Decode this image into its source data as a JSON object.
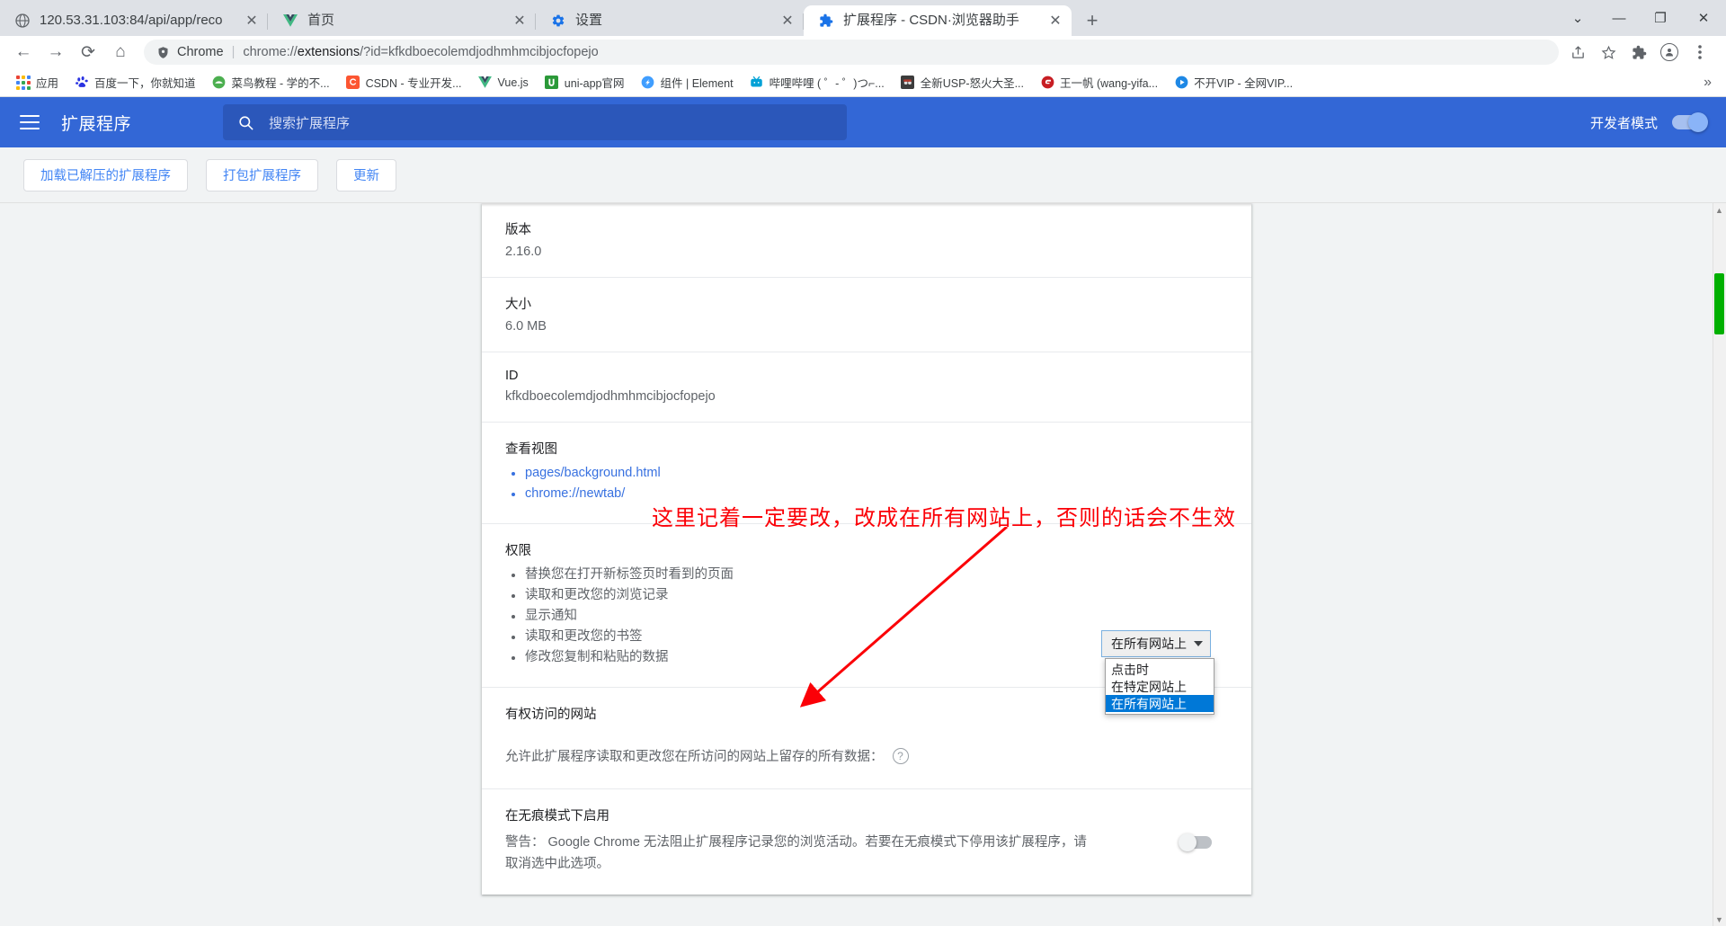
{
  "window": {
    "controls": {
      "minimize": "—",
      "maximize": "❐",
      "close": "✕",
      "list_tabs": "⌄"
    }
  },
  "tabs": [
    {
      "title": "120.53.31.103:84/api/app/reco",
      "favicon": "globe-icon",
      "active": false,
      "close": "✕"
    },
    {
      "title": "首页",
      "favicon": "vue-icon",
      "active": false,
      "close": "✕"
    },
    {
      "title": "设置",
      "favicon": "settings-gear-icon",
      "active": false,
      "close": "✕"
    },
    {
      "title": "扩展程序 - CSDN·浏览器助手",
      "favicon": "puzzle-icon",
      "active": true,
      "close": "✕"
    }
  ],
  "newtab_label": "+",
  "omnibox": {
    "back": "←",
    "forward": "→",
    "reload": "⟳",
    "home": "⌂",
    "chrome_label": "Chrome",
    "separator": "|",
    "url_prefix": "chrome://",
    "url_bold": "extensions",
    "url_suffix": "/?id=kfkdboecolemdjodhmhmcibjocfopejo",
    "full_url": "chrome://extensions/?id=kfkdboecolemdjodhmhmcibjocfopejo",
    "share_icon": "share-icon",
    "bookmark_icon": "star-icon",
    "extensions_icon": "puzzle-icon",
    "profile_icon": "profile-avatar-icon",
    "menu_icon": "more-vertical-icon"
  },
  "bookmarks": {
    "items": [
      {
        "label": "应用",
        "icon": "apps-grid-icon"
      },
      {
        "label": "百度一下，你就知道",
        "icon": "baidu-icon"
      },
      {
        "label": "菜鸟教程 - 学的不...",
        "icon": "runoob-icon"
      },
      {
        "label": "CSDN - 专业开发...",
        "icon": "csdn-icon"
      },
      {
        "label": "Vue.js",
        "icon": "vue-icon"
      },
      {
        "label": "uni-app官网",
        "icon": "uniapp-icon"
      },
      {
        "label": "组件 | Element",
        "icon": "element-icon"
      },
      {
        "label": "哔哩哔哩 ( ゜- ゜)つ⌐...",
        "icon": "bilibili-icon"
      },
      {
        "label": "全新USP-怒火大圣...",
        "icon": "usp-icon"
      },
      {
        "label": "王一帆 (wang-yifa...",
        "icon": "gitee-icon"
      },
      {
        "label": "不开VIP - 全网VIP...",
        "icon": "video-play-icon"
      }
    ],
    "overflow": "»"
  },
  "ext_header": {
    "menu_icon": "hamburger-menu-icon",
    "title": "扩展程序",
    "search_icon": "search-icon",
    "search_placeholder": "搜索扩展程序",
    "search_value": "",
    "devmode_label": "开发者模式",
    "devmode_on": true,
    "bg_color": "#3367d6",
    "search_bg_color": "#2b57ba"
  },
  "ext_toolbar": {
    "buttons": [
      {
        "label": "加载已解压的扩展程序"
      },
      {
        "label": "打包扩展程序"
      },
      {
        "label": "更新"
      }
    ],
    "accent_color": "#4285f4"
  },
  "detail": {
    "version": {
      "label": "版本",
      "value": "2.16.0"
    },
    "size": {
      "label": "大小",
      "value": "6.0 MB"
    },
    "id": {
      "label": "ID",
      "value": "kfkdboecolemdjodhmhmcibjocfopejo"
    },
    "views": {
      "label": "查看视图",
      "items": [
        "pages/background.html",
        "chrome://newtab/"
      ]
    },
    "permissions": {
      "label": "权限",
      "items": [
        "替换您在打开新标签页时看到的页面",
        "读取和更改您的浏览记录",
        "显示通知",
        "读取和更改您的书签",
        "修改您复制和粘贴的数据"
      ]
    },
    "site_access": {
      "label": "有权访问的网站",
      "question": "允许此扩展程序读取和更改您在所访问的网站上留存的所有数据：",
      "help_icon": "help-circle-icon",
      "dropdown": {
        "selected": "在所有网站上",
        "open": true,
        "options": [
          "点击时",
          "在特定网站上",
          "在所有网站上"
        ],
        "highlight_color": "#0078d7"
      }
    },
    "incognito": {
      "label": "在无痕模式下启用",
      "warning": "警告： Google Chrome 无法阻止扩展程序记录您的浏览活动。若要在无痕模式下停用该扩展程序，请取消选中此选项。",
      "enabled": false
    }
  },
  "annotation": {
    "text": "这里记着一定要改，改成在所有网站上，否则的话会不生效",
    "color": "#fb0007",
    "arrow": "red-arrow-annotation"
  },
  "scrollbar": {
    "thumb_color": "#00b000",
    "up_arrow": "▲",
    "down_arrow": "▼"
  }
}
